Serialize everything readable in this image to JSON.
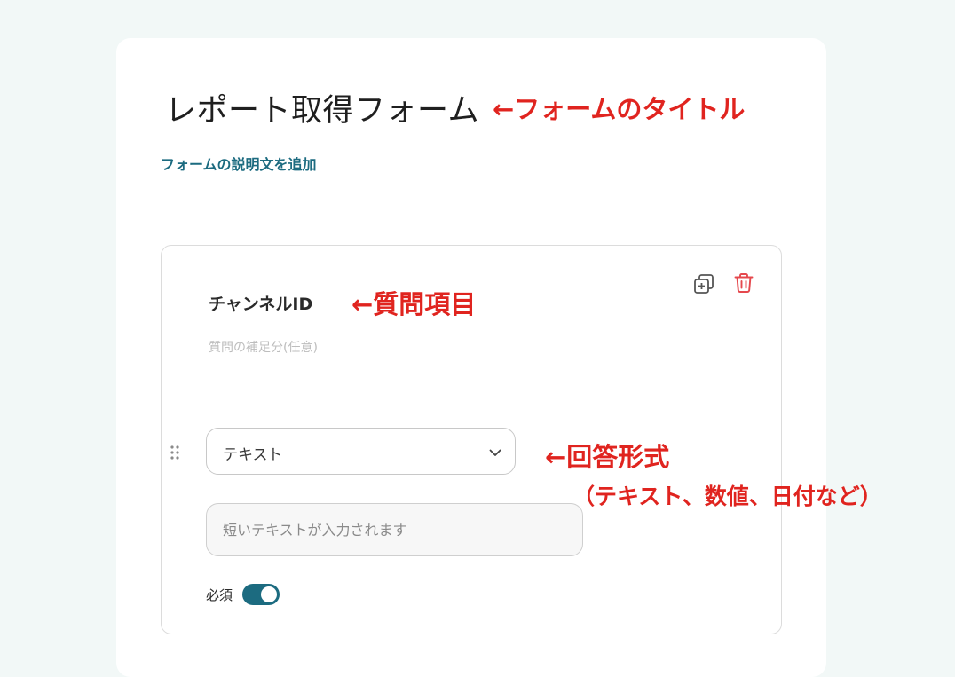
{
  "form": {
    "title": "レポート取得フォーム",
    "description_link": "フォームの説明文を追加"
  },
  "question": {
    "title": "チャンネルID",
    "description_placeholder": "質問の補足分(任意)",
    "answer_type": "テキスト",
    "preview_placeholder": "短いテキストが入力されます",
    "required_label": "必須",
    "required": true
  },
  "annotations": {
    "title": "←フォームのタイトル",
    "question": "←質問項目",
    "answer": "←回答形式",
    "answer_sub": "（テキスト、数値、日付など）"
  },
  "icons": {
    "copy": "copy-icon",
    "trash": "trash-icon",
    "drag": "drag-handle-icon",
    "chevron": "chevron-down-icon"
  },
  "colors": {
    "accent": "#1c6b80",
    "annotation": "#e0241f",
    "trash": "#e5484d",
    "background": "#f2f8f7"
  }
}
